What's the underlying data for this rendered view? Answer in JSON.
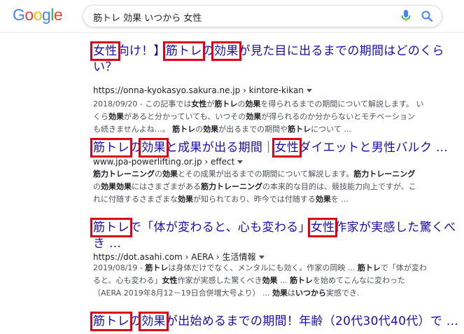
{
  "header": {
    "logo_letters": [
      {
        "ch": "G",
        "color": "#4285F4"
      },
      {
        "ch": "o",
        "color": "#EA4335"
      },
      {
        "ch": "o",
        "color": "#FBBC05"
      },
      {
        "ch": "g",
        "color": "#4285F4"
      },
      {
        "ch": "l",
        "color": "#34A853"
      },
      {
        "ch": "e",
        "color": "#EA4335"
      }
    ],
    "query": "筋トレ 効果 いつから 女性",
    "mic_icon": "mic-icon",
    "search_icon": "search-icon"
  },
  "results": [
    {
      "title_lines": [
        [
          {
            "t": " "
          },
          {
            "t": "女性",
            "hl": true
          },
          {
            "t": "向け！】"
          },
          {
            "t": "筋トレ",
            "hl": true
          },
          {
            "t": "の"
          },
          {
            "t": "効果",
            "hl": true
          },
          {
            "t": "が見た目に出るまでの期間はどのくら"
          }
        ],
        [
          {
            "t": "い？"
          }
        ]
      ],
      "url": "https://onna-kyokasyo.sakura.ne.jp › kintore-kikan",
      "snippet_lines": [
        [
          {
            "t": "2018/09/20 - この記事では"
          },
          {
            "t": "女性",
            "b": true
          },
          {
            "t": "が"
          },
          {
            "t": "筋トレ",
            "b": true
          },
          {
            "t": "の"
          },
          {
            "t": "効果",
            "b": true
          },
          {
            "t": "を得られるまでの期間について解説します。 い"
          }
        ],
        [
          {
            "t": "くら"
          },
          {
            "t": "効果",
            "b": true
          },
          {
            "t": "があると分かっていても、いつその"
          },
          {
            "t": "効果",
            "b": true
          },
          {
            "t": "が得られるのか分からないとモチベーション"
          }
        ],
        [
          {
            "t": "も続きませんよね…。 "
          },
          {
            "t": "筋トレ",
            "b": true
          },
          {
            "t": "の"
          },
          {
            "t": "効果",
            "b": true
          },
          {
            "t": "が出るまでの期間や"
          },
          {
            "t": "筋トレ",
            "b": true
          },
          {
            "t": "について ..."
          }
        ]
      ]
    },
    {
      "title_lines": [
        [
          {
            "t": "筋トレ",
            "hl": true
          },
          {
            "t": "の"
          },
          {
            "t": "効果",
            "hl": true
          },
          {
            "t": "と成果が出る期間｜"
          },
          {
            "t": "女性",
            "hl": true
          },
          {
            "t": "ダイエットと男性バルク ..."
          }
        ]
      ],
      "url": "www.jpa-powerlifting.or.jp › effect",
      "snippet_lines": [
        [
          {
            "t": "筋力トレーニング",
            "b": true
          },
          {
            "t": "の"
          },
          {
            "t": "効果",
            "b": true
          },
          {
            "t": "とその成果が出るまでの期間について解説します。"
          },
          {
            "t": "筋力トレーニング",
            "b": true
          }
        ],
        [
          {
            "t": "の"
          },
          {
            "t": "効果効果",
            "b": true
          },
          {
            "t": "にはさまざまがある"
          },
          {
            "t": "筋力トレーニング",
            "b": true
          },
          {
            "t": "の本来的な目的は、競技能力向上ですが、こ"
          }
        ],
        [
          {
            "t": "れに付随するさまざまな"
          },
          {
            "t": "効果",
            "b": true
          },
          {
            "t": "が知られており、昨今では付随する"
          },
          {
            "t": "効果",
            "b": true
          },
          {
            "t": "を ..."
          }
        ]
      ]
    },
    {
      "title_lines": [
        [
          {
            "t": "筋トレ",
            "hl": true
          },
          {
            "t": "で「体が変わると、心も変わる」"
          },
          {
            "t": "女性",
            "hl": true
          },
          {
            "t": "作家が実感した驚くべ"
          }
        ],
        [
          {
            "t": "き ..."
          }
        ]
      ],
      "url": "https://dot.asahi.com › AERA › 生活情報",
      "snippet_lines": [
        [
          {
            "t": "2019/08/19 - "
          },
          {
            "t": "筋トレ",
            "b": true
          },
          {
            "t": "は身体だけでなく、メンタルにも効く。作家の岡映 ... "
          },
          {
            "t": "筋トレ",
            "b": true
          },
          {
            "t": "で「体が変わ"
          }
        ],
        [
          {
            "t": "ると、心も変わる」"
          },
          {
            "t": "女性",
            "b": true
          },
          {
            "t": "作家が実感した驚くべき"
          },
          {
            "t": "効果",
            "b": true
          },
          {
            "t": " ... "
          },
          {
            "t": "筋トレ",
            "b": true
          },
          {
            "t": "を始めてこんなに変わった"
          }
        ],
        [
          {
            "t": "（AERA 2019年8月12－19日合併増大号より） ... "
          },
          {
            "t": "効果",
            "b": true
          },
          {
            "t": "は"
          },
          {
            "t": "いつから",
            "b": true
          },
          {
            "t": "実感でき."
          }
        ]
      ]
    },
    {
      "title_lines": [
        [
          {
            "t": "筋トレ",
            "hl": true
          },
          {
            "t": "の"
          },
          {
            "t": "効果",
            "hl": true
          },
          {
            "t": "が出始めるまでの期間！年齢（20代30代40代）で ..."
          }
        ]
      ],
      "url": "",
      "snippet_lines": []
    }
  ]
}
